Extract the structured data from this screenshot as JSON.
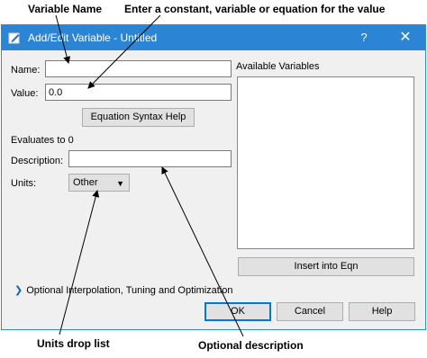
{
  "callouts": {
    "variable_name": "Variable Name",
    "value_hint": "Enter a constant, variable or equation for the value",
    "units_drop_list": "Units drop list",
    "optional_description": "Optional description"
  },
  "dialog": {
    "title": "Add/Edit Variable - Untitled",
    "help_glyph": "?",
    "close_glyph": "✕",
    "name_label": "Name:",
    "name_value": "",
    "value_label": "Value:",
    "value_value": "0.0",
    "syntax_help_button": "Equation Syntax Help",
    "evaluates_text": "Evaluates to 0",
    "description_label": "Description:",
    "description_value": "",
    "units_label": "Units:",
    "units_selected": "Other",
    "available_variables_label": "Available Variables",
    "insert_button": "Insert into Eqn",
    "optional_expander": "Optional Interpolation, Tuning and Optimization",
    "ok_button": "OK",
    "cancel_button": "Cancel",
    "help_button": "Help"
  },
  "colors": {
    "titlebar": "#2b84d4",
    "dialog_bg": "#f0f0f0",
    "default_button_border": "#0078d7"
  }
}
